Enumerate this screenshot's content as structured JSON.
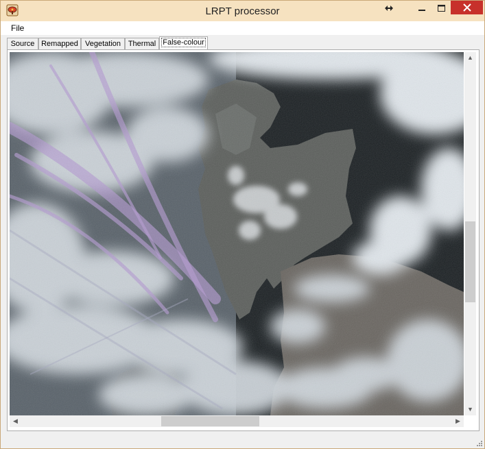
{
  "window": {
    "title": "LRPT processor",
    "icons": {
      "app": "satellite-dish-icon",
      "resize": "horizontal-resize-icon",
      "minimize": "minimize-icon",
      "maximize": "maximize-icon",
      "close": "close-icon"
    },
    "colors": {
      "titlebar": "#f6e2c0",
      "close": "#c7312b",
      "border": "#c9a878"
    }
  },
  "menu": {
    "file": "File"
  },
  "tabs": [
    {
      "label": "Source"
    },
    {
      "label": "Remapped"
    },
    {
      "label": "Vegetation"
    },
    {
      "label": "Thermal"
    },
    {
      "label": "False-colour",
      "active": true
    }
  ],
  "image": {
    "icon": "satellite-false-colour-image"
  },
  "scrollbars": {
    "vertical": {
      "up_icon": "chevron-up-icon",
      "down_icon": "chevron-down-icon"
    },
    "horizontal": {
      "left_icon": "chevron-left-icon",
      "right_icon": "chevron-right-icon"
    }
  }
}
